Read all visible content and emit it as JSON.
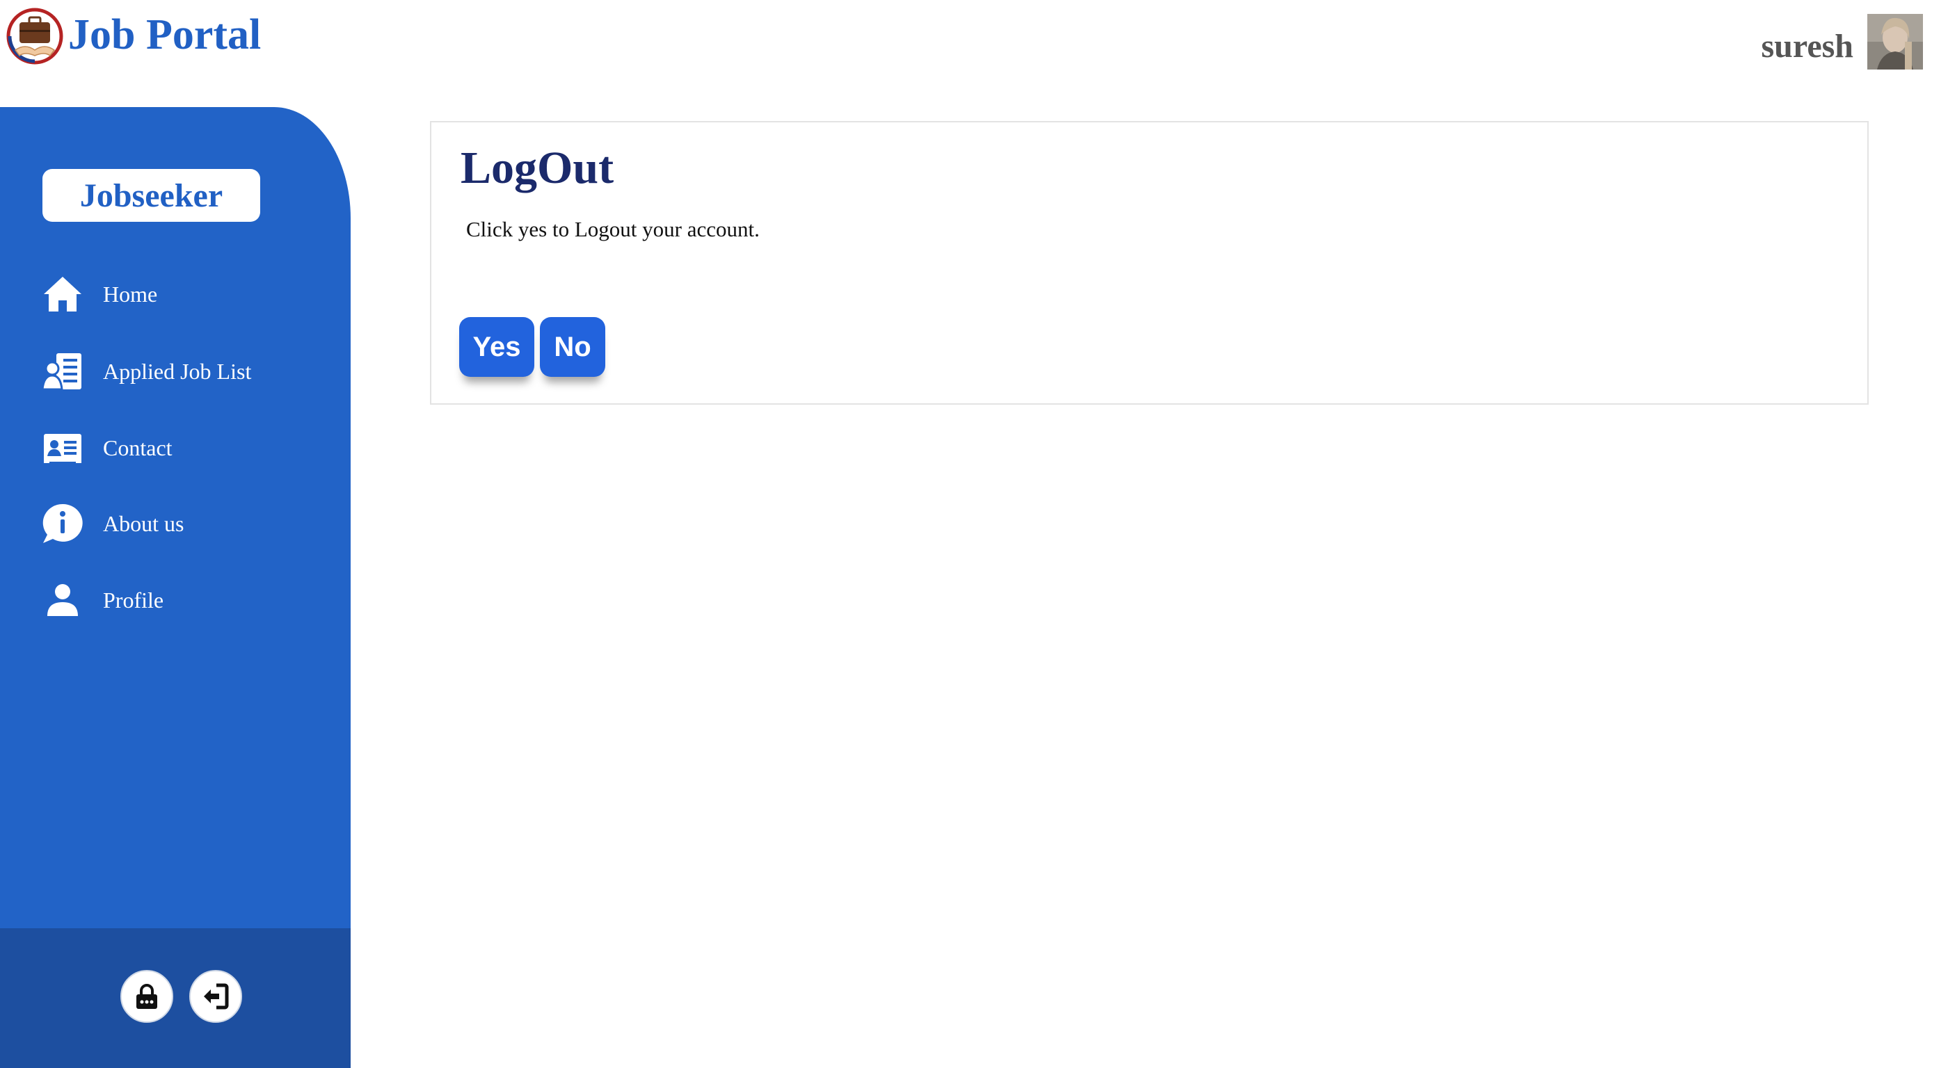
{
  "header": {
    "app_title": "Job Portal",
    "username": "suresh"
  },
  "sidebar": {
    "role": "Jobseeker",
    "items": [
      {
        "label": "Home",
        "icon": "home-icon"
      },
      {
        "label": "Applied Job List",
        "icon": "job-list-icon"
      },
      {
        "label": "Contact",
        "icon": "contact-card-icon"
      },
      {
        "label": "About us",
        "icon": "info-icon"
      },
      {
        "label": "Profile",
        "icon": "user-icon"
      }
    ],
    "footer": [
      {
        "icon": "lock-icon"
      },
      {
        "icon": "logout-icon"
      }
    ]
  },
  "main": {
    "title": "LogOut",
    "message": "Click yes to Logout your account.",
    "yes_label": "Yes",
    "no_label": "No"
  },
  "colors": {
    "brand": "#2160c4",
    "sidebar": "#2263c7",
    "sidebar_footer": "#1d4fa0",
    "title": "#1b2a6b",
    "button": "#2263dd"
  }
}
